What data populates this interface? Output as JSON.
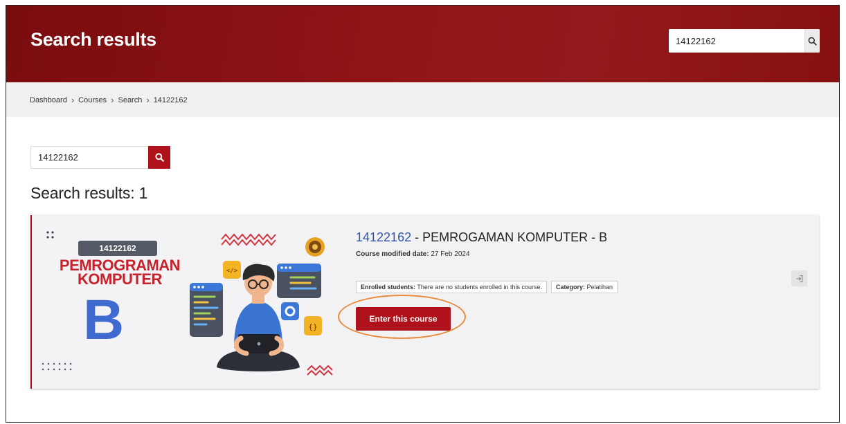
{
  "header": {
    "title": "Search results",
    "search_value": "14122162"
  },
  "breadcrumb": [
    "Dashboard",
    "Courses",
    "Search",
    "14122162"
  ],
  "search": {
    "value": "14122162"
  },
  "results": {
    "heading": "Search results: 1"
  },
  "course": {
    "code": "14122162",
    "name_suffix": " - PEMROGAMAN KOMPUTER - B",
    "modified_label": "Course modified date:",
    "modified_value": "27 Feb 2024",
    "enrolled_label": "Enrolled students:",
    "enrolled_value": "There are no students enrolled in this course.",
    "category_label": "Category:",
    "category_value": "Pelatihan",
    "enter_button": "Enter this course",
    "image": {
      "badge": "14122162",
      "title_line1": "PEMROGRAMAN",
      "title_line2": "KOMPUTER",
      "section": "B"
    }
  },
  "colors": {
    "brand": "#8f1416",
    "accent": "#b0121b",
    "link": "#3254a8",
    "highlight": "#e98a3c"
  },
  "icons": {
    "search": "search-icon",
    "enter": "enter-course-icon"
  }
}
